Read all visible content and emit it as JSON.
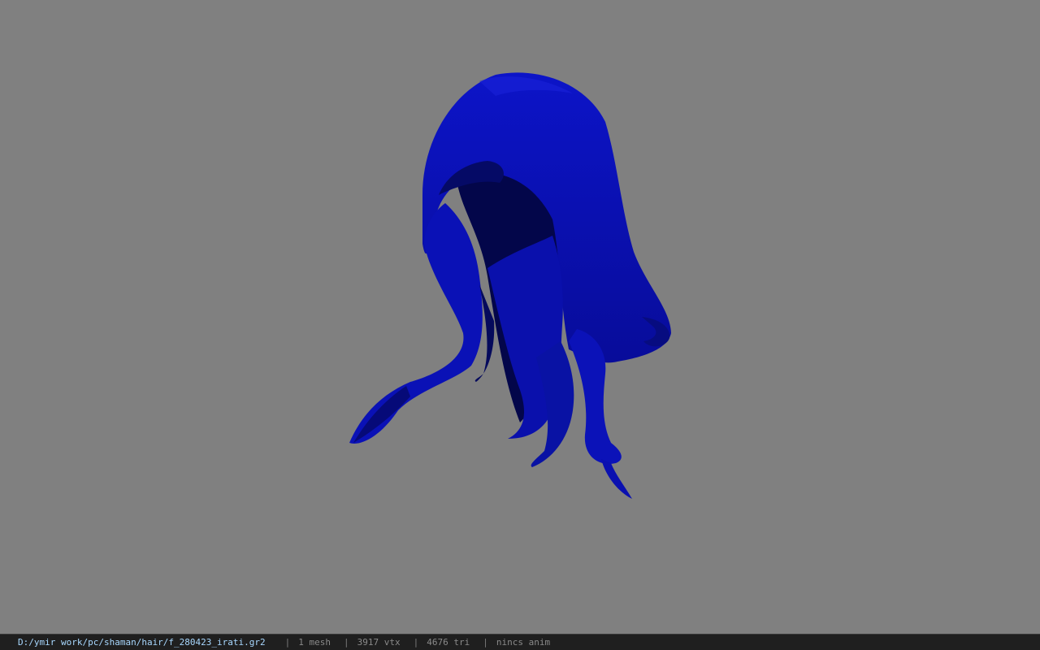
{
  "viewer": {
    "background_color": "#808080",
    "model": {
      "name": "hair-mesh",
      "color": "#0a10b4",
      "shadow_color": "#050a5a"
    }
  },
  "status_bar": {
    "file_path": "D:/ymir work/pc/shaman/hair/f_280423_irati.gr2",
    "separator": "|",
    "mesh_count": "1 mesh",
    "vertex_count": "3917 vtx",
    "triangle_count": "4676 tri",
    "anim_status": "nincs anim"
  }
}
